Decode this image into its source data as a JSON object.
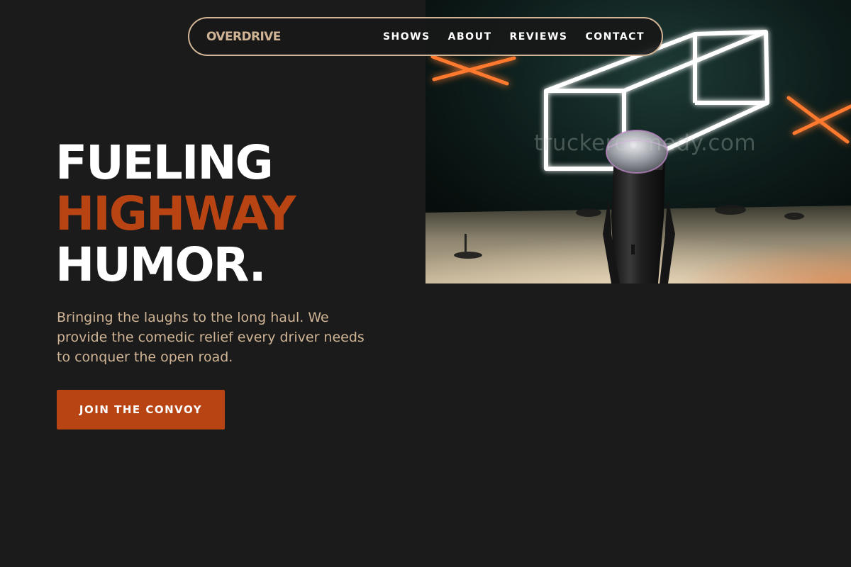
{
  "nav": {
    "brand": "OVERDRIVE",
    "links": [
      "SHOWS",
      "ABOUT",
      "REVIEWS",
      "CONTACT"
    ]
  },
  "hero": {
    "headline_line1": "FUELING",
    "headline_line2": "HIGHWAY",
    "headline_line3": "HUMOR.",
    "subtext": "Bringing the laughs to the long haul. We provide the comedic relief every driver needs to conquer the open road.",
    "cta_label": "JOIN THE CONVOY",
    "image_watermark": "truckercomedy.com"
  },
  "colors": {
    "background": "#1b1b1b",
    "accent": "#b84313",
    "tan": "#cfb495",
    "text": "#ffffff"
  }
}
